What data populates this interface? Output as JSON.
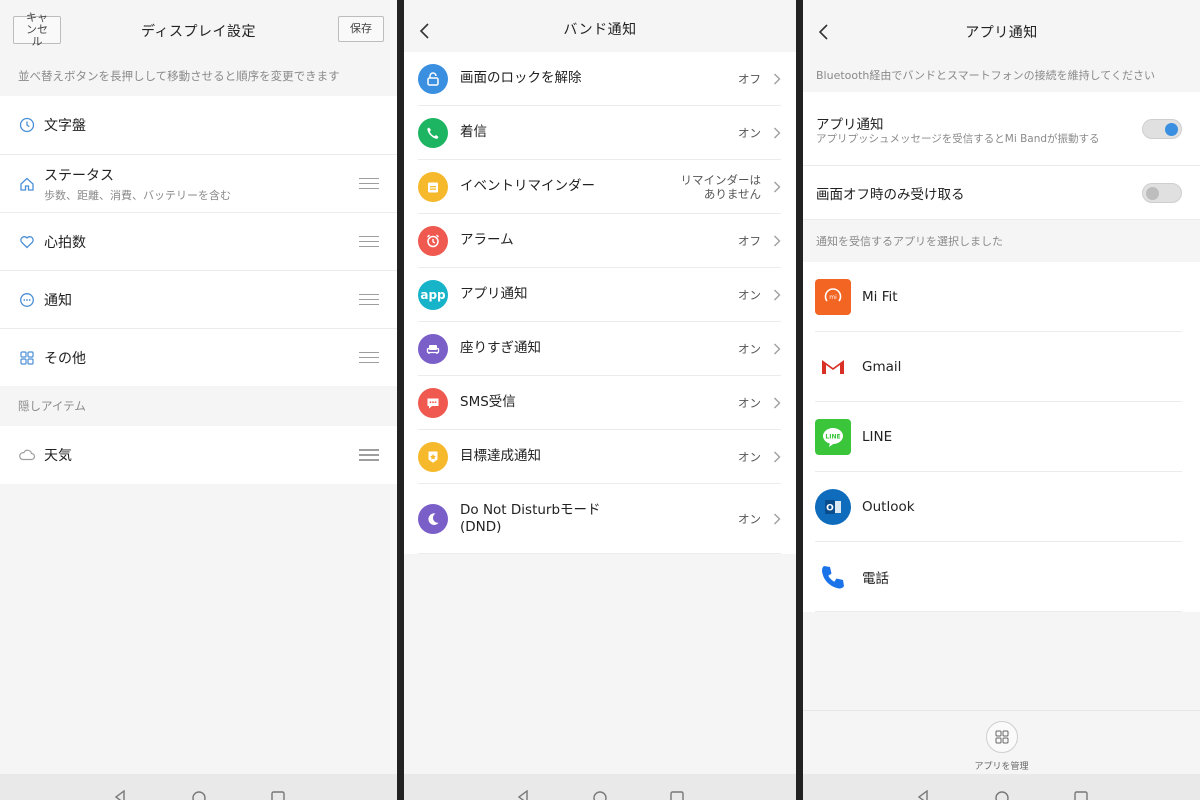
{
  "display_settings": {
    "cancel_label": "キャンセル",
    "title": "ディスプレイ設定",
    "save_label": "保存",
    "hint": "並べ替えボタンを長押しして移動させると順序を変更できます",
    "items": [
      {
        "label": "文字盤",
        "sub": "",
        "icon": "clock-face-icon"
      },
      {
        "label": "ステータス",
        "sub": "歩数、距離、消費、バッテリーを含む",
        "icon": "home-icon"
      },
      {
        "label": "心拍数",
        "sub": "",
        "icon": "heart-icon"
      },
      {
        "label": "通知",
        "sub": "",
        "icon": "chat-bubble-icon"
      },
      {
        "label": "その他",
        "sub": "",
        "icon": "grid-icon"
      }
    ],
    "hidden_label": "隠しアイテム",
    "hidden_items": [
      {
        "label": "天気",
        "icon": "cloud-icon"
      }
    ]
  },
  "band_notifications": {
    "title": "バンド通知",
    "items": [
      {
        "label": "画面のロックを解除",
        "value": "オフ",
        "icon": "unlock-icon",
        "color": "#3a8fe0"
      },
      {
        "label": "着信",
        "value": "オン",
        "icon": "phone-icon",
        "color": "#1db561"
      },
      {
        "label": "イベントリマインダー",
        "value_line1": "リマインダーは",
        "value_line2": "ありません",
        "icon": "calendar-icon",
        "color": "#f6b92c"
      },
      {
        "label": "アラーム",
        "value": "オフ",
        "icon": "alarm-icon",
        "color": "#f0594f"
      },
      {
        "label": "アプリ通知",
        "value": "オン",
        "icon": "app-icon",
        "icon_text": "app",
        "color": "#16b3c9"
      },
      {
        "label": "座りすぎ通知",
        "value": "オン",
        "icon": "sofa-icon",
        "color": "#7b5fc9"
      },
      {
        "label": "SMS受信",
        "value": "オン",
        "icon": "sms-icon",
        "color": "#f0594f"
      },
      {
        "label": "目標達成通知",
        "value": "オン",
        "icon": "badge-icon",
        "color": "#f6b92c"
      },
      {
        "label_line1": "Do Not Disturbモード",
        "label_line2": "(DND)",
        "value": "オン",
        "icon": "moon-icon",
        "color": "#7b5fc9"
      }
    ]
  },
  "app_notifications": {
    "title": "アプリ通知",
    "hint": "Bluetooth経由でバンドとスマートフォンの接続を維持してください",
    "toggle1": {
      "label": "アプリ通知",
      "sub": "アプリプッシュメッセージを受信するとMi Bandが振動する",
      "on": true
    },
    "toggle2": {
      "label": "画面オフ時のみ受け取る",
      "on": false
    },
    "apps_label": "通知を受信するアプリを選択しました",
    "apps": [
      {
        "label": "Mi Fit",
        "icon": "mifit-icon",
        "icon_text": "mi",
        "color": "#f26522"
      },
      {
        "label": "Gmail",
        "icon": "gmail-icon",
        "color": "#d93025"
      },
      {
        "label": "LINE",
        "icon": "line-icon",
        "icon_text": "LINE",
        "color": "#3ac53a"
      },
      {
        "label": "Outlook",
        "icon": "outlook-icon",
        "icon_text": "O",
        "color": "#0f6cbd"
      },
      {
        "label": "電話",
        "icon": "phone-call-icon",
        "color": "#1a73e8"
      }
    ],
    "manage_label": "アプリを管理"
  },
  "colors": {
    "accent": "#3a8fe0",
    "switch_on": "#3a8fe0"
  }
}
